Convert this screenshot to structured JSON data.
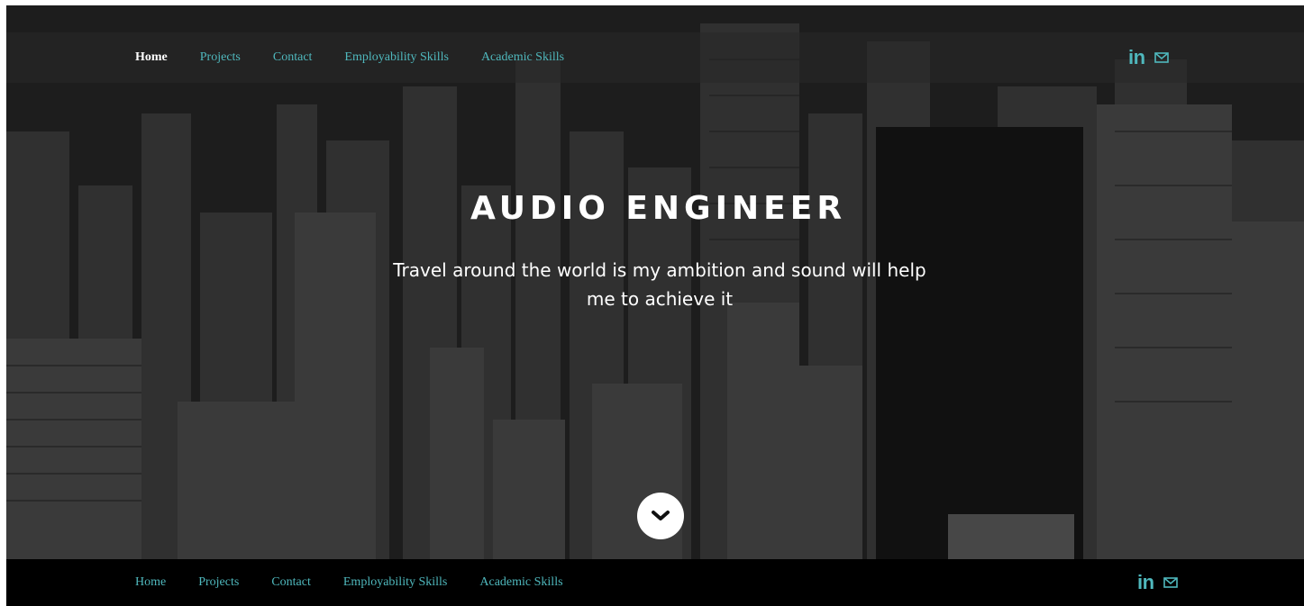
{
  "top_nav": {
    "items": [
      {
        "label": "Home",
        "active": true
      },
      {
        "label": "Projects",
        "active": false
      },
      {
        "label": "Contact",
        "active": false
      },
      {
        "label": "Employability Skills",
        "active": false
      },
      {
        "label": "Academic Skills",
        "active": false
      }
    ],
    "social": {
      "linkedin_text": "in",
      "linkedin_icon": "linkedin-icon",
      "mail_icon": "mail-icon"
    }
  },
  "hero": {
    "title": "AUDIO ENGINEER",
    "tagline_line1": "Travel around the world is my ambition and sound will help",
    "tagline_line2": "me to achieve it",
    "scroll_icon": "chevron-down-icon"
  },
  "bottom_nav": {
    "items": [
      {
        "label": "Home"
      },
      {
        "label": "Projects"
      },
      {
        "label": "Contact"
      },
      {
        "label": "Employability Skills"
      },
      {
        "label": "Academic Skills"
      }
    ],
    "social": {
      "linkedin_text": "in",
      "linkedin_icon": "linkedin-icon",
      "mail_icon": "mail-icon"
    }
  },
  "colors": {
    "accent": "#4fb8bd",
    "active_link": "#ffffff",
    "footer_bg": "#000000"
  }
}
